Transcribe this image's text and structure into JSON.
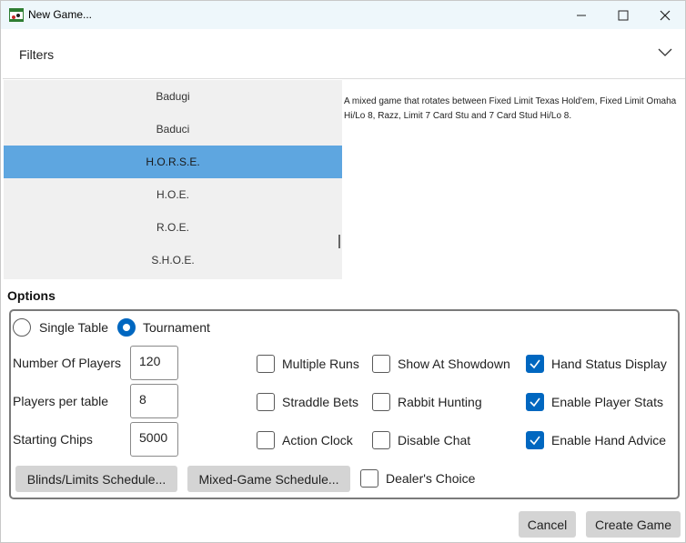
{
  "window": {
    "title": "New Game..."
  },
  "filters": {
    "label": "Filters"
  },
  "games": {
    "items": [
      "Badugi",
      "Baduci",
      "H.O.R.S.E.",
      "H.O.E.",
      "R.O.E.",
      "S.H.O.E."
    ],
    "selected": "H.O.R.S.E."
  },
  "description": "A mixed game that rotates between Fixed Limit Texas Hold'em, Fixed Limit Omaha Hi/Lo 8, Razz, Limit 7 Card Stu and 7 Card Stud Hi/Lo 8.",
  "options": {
    "heading": "Options",
    "mode": {
      "single_table": "Single Table",
      "tournament": "Tournament",
      "selected": "Tournament"
    },
    "fields": {
      "num_players_label": "Number Of Players",
      "num_players_value": "120",
      "players_per_table_label": "Players per table",
      "players_per_table_value": "8",
      "starting_chips_label": "Starting Chips",
      "starting_chips_value": "5000"
    },
    "checkboxes": {
      "multiple_runs": {
        "label": "Multiple Runs",
        "checked": false
      },
      "show_at_showdown": {
        "label": "Show At Showdown",
        "checked": false
      },
      "hand_status_display": {
        "label": "Hand Status Display",
        "checked": true
      },
      "straddle_bets": {
        "label": "Straddle Bets",
        "checked": false
      },
      "rabbit_hunting": {
        "label": "Rabbit Hunting",
        "checked": false
      },
      "enable_player_stats": {
        "label": "Enable Player Stats",
        "checked": true
      },
      "action_clock": {
        "label": "Action Clock",
        "checked": false
      },
      "disable_chat": {
        "label": "Disable Chat",
        "checked": false
      },
      "enable_hand_advice": {
        "label": "Enable Hand Advice",
        "checked": true
      },
      "dealers_choice": {
        "label": "Dealer's Choice",
        "checked": false
      }
    },
    "buttons": {
      "blinds_schedule": "Blinds/Limits Schedule...",
      "mixed_game_schedule": "Mixed-Game Schedule..."
    }
  },
  "footer": {
    "cancel": "Cancel",
    "create_game": "Create Game"
  },
  "colors": {
    "accent": "#0067c0",
    "selection": "#5ea6e0",
    "list_bg": "#f0f0f0",
    "button_bg": "#d4d4d4"
  }
}
